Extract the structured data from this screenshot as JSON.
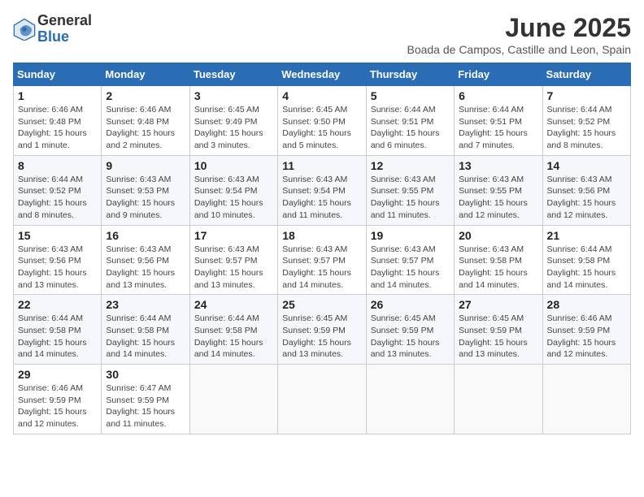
{
  "logo": {
    "general": "General",
    "blue": "Blue"
  },
  "header": {
    "title": "June 2025",
    "subtitle": "Boada de Campos, Castille and Leon, Spain"
  },
  "days_of_week": [
    "Sunday",
    "Monday",
    "Tuesday",
    "Wednesday",
    "Thursday",
    "Friday",
    "Saturday"
  ],
  "weeks": [
    [
      {
        "day": "1",
        "info": "Sunrise: 6:46 AM\nSunset: 9:48 PM\nDaylight: 15 hours and 1 minute."
      },
      {
        "day": "2",
        "info": "Sunrise: 6:46 AM\nSunset: 9:48 PM\nDaylight: 15 hours and 2 minutes."
      },
      {
        "day": "3",
        "info": "Sunrise: 6:45 AM\nSunset: 9:49 PM\nDaylight: 15 hours and 3 minutes."
      },
      {
        "day": "4",
        "info": "Sunrise: 6:45 AM\nSunset: 9:50 PM\nDaylight: 15 hours and 5 minutes."
      },
      {
        "day": "5",
        "info": "Sunrise: 6:44 AM\nSunset: 9:51 PM\nDaylight: 15 hours and 6 minutes."
      },
      {
        "day": "6",
        "info": "Sunrise: 6:44 AM\nSunset: 9:51 PM\nDaylight: 15 hours and 7 minutes."
      },
      {
        "day": "7",
        "info": "Sunrise: 6:44 AM\nSunset: 9:52 PM\nDaylight: 15 hours and 8 minutes."
      }
    ],
    [
      {
        "day": "8",
        "info": "Sunrise: 6:44 AM\nSunset: 9:52 PM\nDaylight: 15 hours and 8 minutes."
      },
      {
        "day": "9",
        "info": "Sunrise: 6:43 AM\nSunset: 9:53 PM\nDaylight: 15 hours and 9 minutes."
      },
      {
        "day": "10",
        "info": "Sunrise: 6:43 AM\nSunset: 9:54 PM\nDaylight: 15 hours and 10 minutes."
      },
      {
        "day": "11",
        "info": "Sunrise: 6:43 AM\nSunset: 9:54 PM\nDaylight: 15 hours and 11 minutes."
      },
      {
        "day": "12",
        "info": "Sunrise: 6:43 AM\nSunset: 9:55 PM\nDaylight: 15 hours and 11 minutes."
      },
      {
        "day": "13",
        "info": "Sunrise: 6:43 AM\nSunset: 9:55 PM\nDaylight: 15 hours and 12 minutes."
      },
      {
        "day": "14",
        "info": "Sunrise: 6:43 AM\nSunset: 9:56 PM\nDaylight: 15 hours and 12 minutes."
      }
    ],
    [
      {
        "day": "15",
        "info": "Sunrise: 6:43 AM\nSunset: 9:56 PM\nDaylight: 15 hours and 13 minutes."
      },
      {
        "day": "16",
        "info": "Sunrise: 6:43 AM\nSunset: 9:56 PM\nDaylight: 15 hours and 13 minutes."
      },
      {
        "day": "17",
        "info": "Sunrise: 6:43 AM\nSunset: 9:57 PM\nDaylight: 15 hours and 13 minutes."
      },
      {
        "day": "18",
        "info": "Sunrise: 6:43 AM\nSunset: 9:57 PM\nDaylight: 15 hours and 14 minutes."
      },
      {
        "day": "19",
        "info": "Sunrise: 6:43 AM\nSunset: 9:57 PM\nDaylight: 15 hours and 14 minutes."
      },
      {
        "day": "20",
        "info": "Sunrise: 6:43 AM\nSunset: 9:58 PM\nDaylight: 15 hours and 14 minutes."
      },
      {
        "day": "21",
        "info": "Sunrise: 6:44 AM\nSunset: 9:58 PM\nDaylight: 15 hours and 14 minutes."
      }
    ],
    [
      {
        "day": "22",
        "info": "Sunrise: 6:44 AM\nSunset: 9:58 PM\nDaylight: 15 hours and 14 minutes."
      },
      {
        "day": "23",
        "info": "Sunrise: 6:44 AM\nSunset: 9:58 PM\nDaylight: 15 hours and 14 minutes."
      },
      {
        "day": "24",
        "info": "Sunrise: 6:44 AM\nSunset: 9:58 PM\nDaylight: 15 hours and 14 minutes."
      },
      {
        "day": "25",
        "info": "Sunrise: 6:45 AM\nSunset: 9:59 PM\nDaylight: 15 hours and 13 minutes."
      },
      {
        "day": "26",
        "info": "Sunrise: 6:45 AM\nSunset: 9:59 PM\nDaylight: 15 hours and 13 minutes."
      },
      {
        "day": "27",
        "info": "Sunrise: 6:45 AM\nSunset: 9:59 PM\nDaylight: 15 hours and 13 minutes."
      },
      {
        "day": "28",
        "info": "Sunrise: 6:46 AM\nSunset: 9:59 PM\nDaylight: 15 hours and 12 minutes."
      }
    ],
    [
      {
        "day": "29",
        "info": "Sunrise: 6:46 AM\nSunset: 9:59 PM\nDaylight: 15 hours and 12 minutes."
      },
      {
        "day": "30",
        "info": "Sunrise: 6:47 AM\nSunset: 9:59 PM\nDaylight: 15 hours and 11 minutes."
      },
      {
        "day": "",
        "info": ""
      },
      {
        "day": "",
        "info": ""
      },
      {
        "day": "",
        "info": ""
      },
      {
        "day": "",
        "info": ""
      },
      {
        "day": "",
        "info": ""
      }
    ]
  ]
}
